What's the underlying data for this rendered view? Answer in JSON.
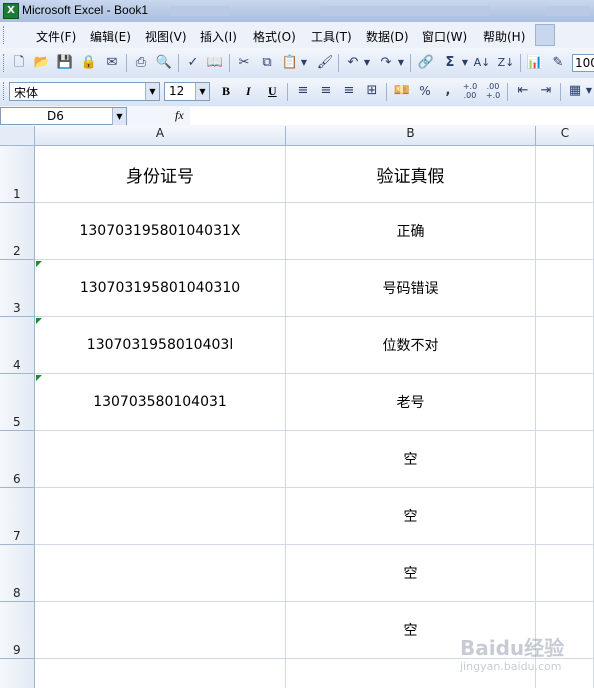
{
  "window": {
    "title": "Microsoft Excel - Book1",
    "app_icon": "X"
  },
  "menu": [
    {
      "label": "文件(F)"
    },
    {
      "label": "编辑(E)"
    },
    {
      "label": "视图(V)"
    },
    {
      "label": "插入(I)"
    },
    {
      "label": "格式(O)"
    },
    {
      "label": "工具(T)"
    },
    {
      "label": "数据(D)"
    },
    {
      "label": "窗口(W)"
    },
    {
      "label": "帮助(H)"
    }
  ],
  "toolbar": {
    "zoom": "100",
    "sigma": "Σ"
  },
  "format_bar": {
    "font_name": "宋体",
    "font_size": "12",
    "bold": "B",
    "italic": "I",
    "underline": "U",
    "percent": "%",
    "comma": ",",
    "inc_decimal": "+.0 .00",
    "dec_decimal": ".00 +.0"
  },
  "formula_bar": {
    "name_box": "D6",
    "fx": "fx",
    "formula": ""
  },
  "columns": [
    "A",
    "B",
    "C"
  ],
  "rows": [
    {
      "num": "1",
      "a": "身份证号",
      "b": "验证真假"
    },
    {
      "num": "2",
      "a": "13070319580104031X",
      "b": "正确"
    },
    {
      "num": "3",
      "a": "130703195801040310",
      "b": "号码错误"
    },
    {
      "num": "4",
      "a": "1307031958010403l",
      "b": "位数不对"
    },
    {
      "num": "5",
      "a": "130703580104031",
      "b": "老号"
    },
    {
      "num": "6",
      "a": "",
      "b": "空"
    },
    {
      "num": "7",
      "a": "",
      "b": "空"
    },
    {
      "num": "8",
      "a": "",
      "b": "空"
    },
    {
      "num": "9",
      "a": "",
      "b": "空"
    }
  ],
  "watermark": {
    "text": "Baidu经验",
    "sub": "jingyan.baidu.com"
  },
  "colors": {
    "error_marker": "#1f8a2e",
    "grid": "#d0d7e5",
    "header_bg": "#dfe8f5"
  }
}
